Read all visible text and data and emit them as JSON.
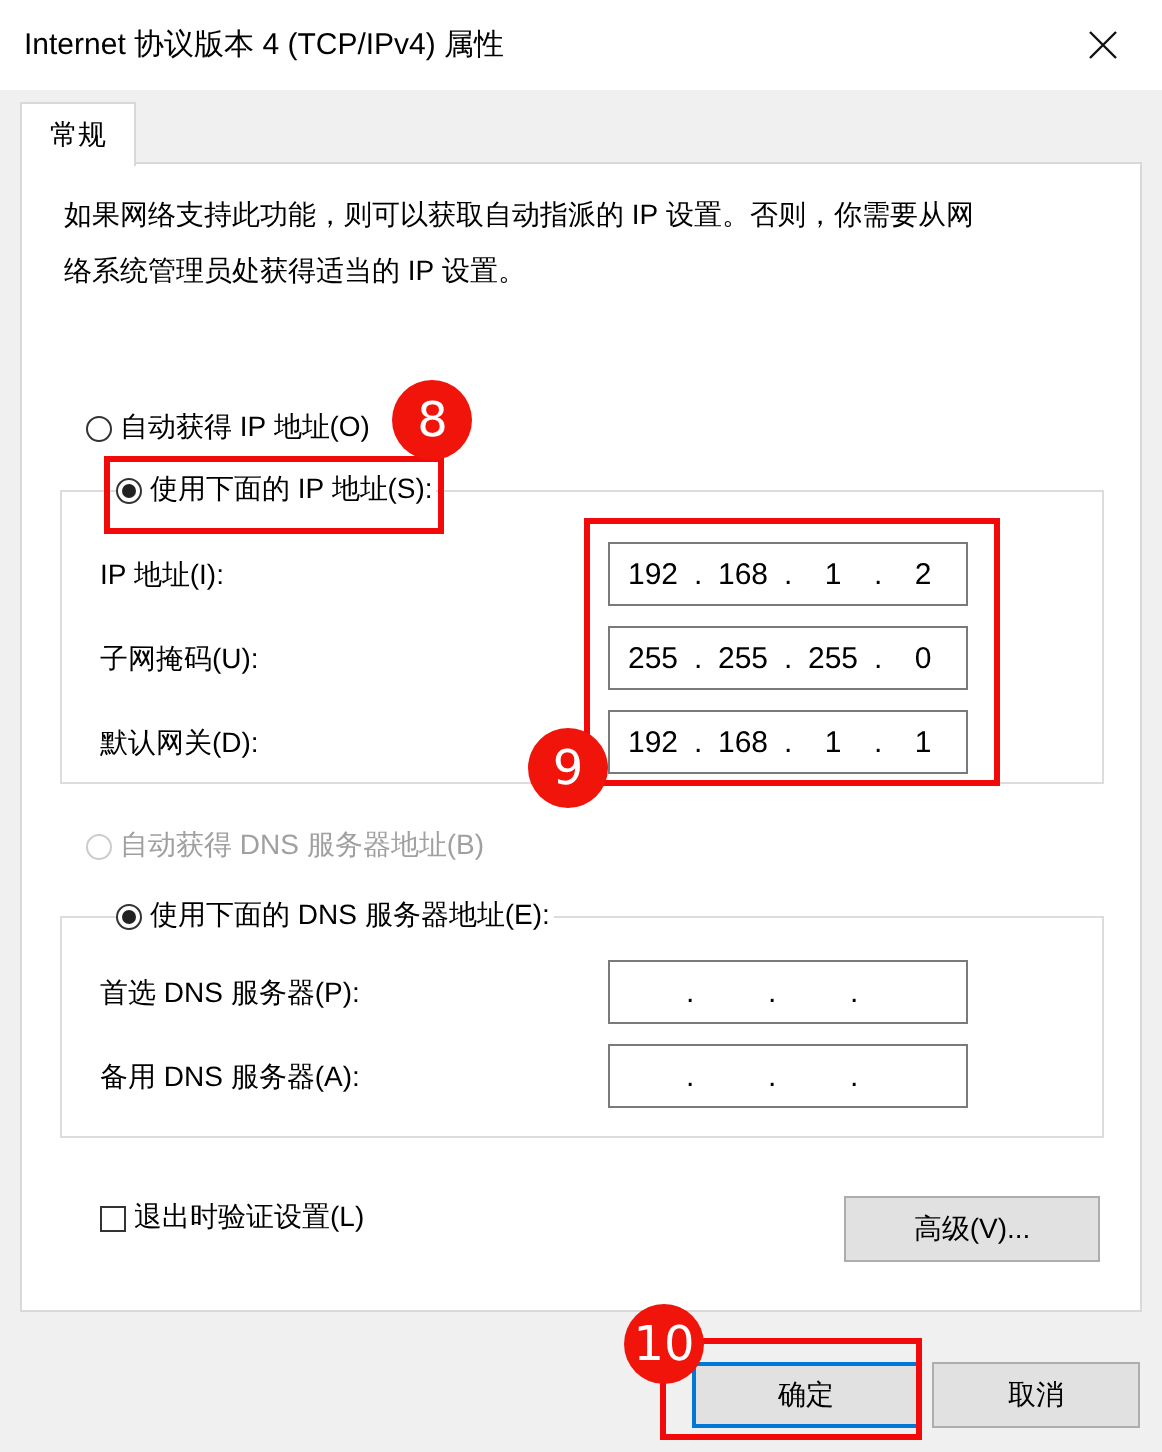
{
  "window": {
    "title": "Internet 协议版本 4 (TCP/IPv4) 属性"
  },
  "tabs": [
    {
      "label": "常规",
      "selected": true
    }
  ],
  "description": "如果网络支持此功能，则可以获取自动指派的 IP 设置。否则，你需要从网络系统管理员处获得适当的 IP 设置。",
  "ip": {
    "mode_options": [
      {
        "label": "自动获得 IP 地址(O)",
        "selected": false,
        "disabled": false
      },
      {
        "label": "使用下面的 IP 地址(S):",
        "selected": true,
        "disabled": false,
        "callout": "8"
      }
    ],
    "fields": [
      {
        "label": "IP 地址(I):",
        "value": "192 . 168 . 1 . 2"
      },
      {
        "label": "子网掩码(U):",
        "value": "255 . 255 . 255 . 0"
      },
      {
        "label": "默认网关(D):",
        "value": "192 . 168 . 1 . 1"
      }
    ],
    "fields_callout": "9"
  },
  "dns": {
    "mode_options": [
      {
        "label": "自动获得 DNS 服务器地址(B)",
        "selected": false,
        "disabled": true
      },
      {
        "label": "使用下面的 DNS 服务器地址(E):",
        "selected": true,
        "disabled": false
      }
    ],
    "fields": [
      {
        "label": "首选 DNS 服务器(P):",
        "value": ". . ."
      },
      {
        "label": "备用 DNS 服务器(A):",
        "value": ". . ."
      }
    ]
  },
  "validate_on_exit": {
    "label": "退出时验证设置(L)",
    "checked": false
  },
  "advanced_button": "高级(V)...",
  "buttons": [
    {
      "label": "确定",
      "default": true,
      "callout": "10"
    },
    {
      "label": "取消",
      "default": false
    }
  ]
}
